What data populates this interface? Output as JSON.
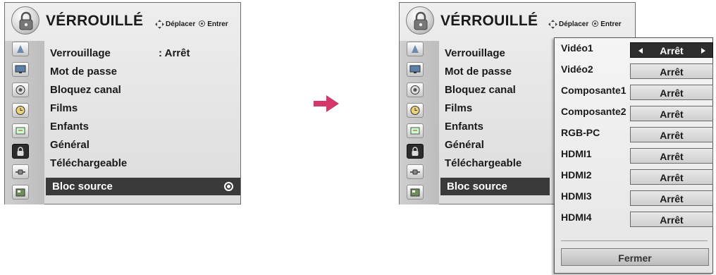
{
  "menu": {
    "title": "VÉRROUILLÉ",
    "hint_move": "Déplacer",
    "hint_enter": "Entrer",
    "items": [
      {
        "label": "Verrouillage",
        "value": ": Arrêt"
      },
      {
        "label": "Mot de passe"
      },
      {
        "label": "Bloquez canal"
      },
      {
        "label": "Films"
      },
      {
        "label": "Enfants"
      },
      {
        "label": "Général"
      },
      {
        "label": "Téléchargeable"
      },
      {
        "label": "Bloc source"
      }
    ],
    "selected": "Bloc source",
    "icons": [
      "setup-icon",
      "picture-icon",
      "audio-icon",
      "time-icon",
      "option-icon",
      "lock-icon",
      "input-icon",
      "usb-icon"
    ],
    "active_icon": "lock-icon"
  },
  "submenu": {
    "rows": [
      {
        "label": "Vidéo1",
        "value": "Arrêt"
      },
      {
        "label": "Vidéo2",
        "value": "Arrêt"
      },
      {
        "label": "Composante1",
        "value": "Arrêt"
      },
      {
        "label": "Composante2",
        "value": "Arrêt"
      },
      {
        "label": "RGB-PC",
        "value": "Arrêt"
      },
      {
        "label": "HDMI1",
        "value": "Arrêt"
      },
      {
        "label": "HDMI2",
        "value": "Arrêt"
      },
      {
        "label": "HDMI3",
        "value": "Arrêt"
      },
      {
        "label": "HDMI4",
        "value": "Arrêt"
      }
    ],
    "active_row": "Vidéo1",
    "close_label": "Fermer"
  },
  "colors": {
    "selection": "#3a3a3a",
    "arrow": "#d6376a"
  }
}
